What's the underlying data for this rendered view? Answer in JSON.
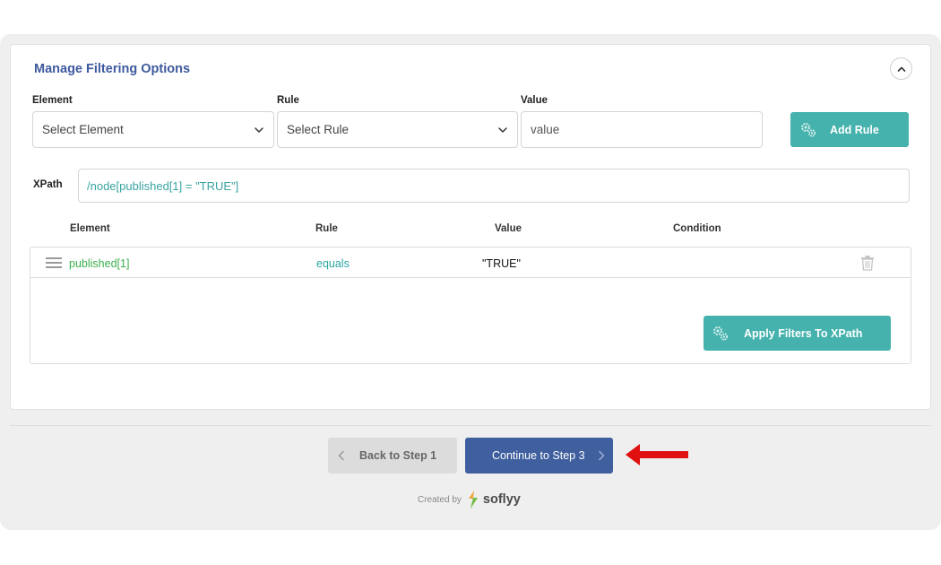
{
  "panel": {
    "title": "Manage Filtering Options"
  },
  "form": {
    "element_label": "Element",
    "element_value": "Select Element",
    "rule_label": "Rule",
    "rule_value": "Select Rule",
    "value_label": "Value",
    "value_placeholder": "value",
    "add_rule_label": "Add Rule"
  },
  "xpath": {
    "label": "XPath",
    "value": "/node[published[1] = \"TRUE\"]"
  },
  "table": {
    "headers": [
      "Element",
      "Rule",
      "Value",
      "Condition"
    ],
    "rows": [
      {
        "element": "published[1]",
        "rule": "equals",
        "value": "\"TRUE\"",
        "condition": ""
      }
    ]
  },
  "apply_button_label": "Apply Filters To XPath",
  "nav": {
    "back_label": "Back to Step 1",
    "continue_label": "Continue to Step 3"
  },
  "footer": {
    "created_by": "Created by",
    "brand": "soflyy"
  },
  "colors": {
    "accent_teal": "#45b2ad",
    "primary_blue": "#3f5f9e",
    "title_blue": "#3d5a9e",
    "annotation_red": "#e01010"
  }
}
